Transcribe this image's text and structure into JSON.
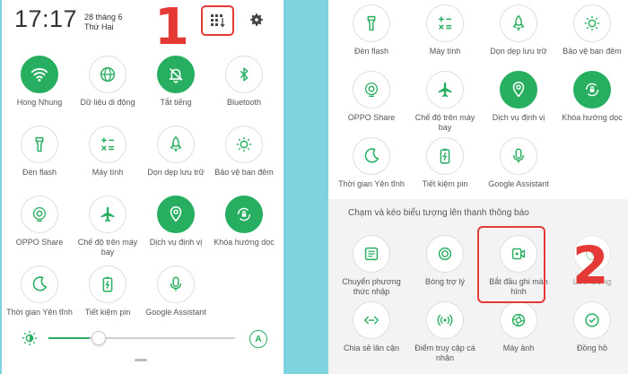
{
  "left_panel": {
    "time": "17:17",
    "date_line1": "28 tháng 6",
    "date_line2": "Thứ Hai",
    "tiles": [
      {
        "label": "Hong Nhung",
        "icon": "wifi-icon",
        "on": true
      },
      {
        "label": "Dữ liệu di động",
        "icon": "globe-icon",
        "on": false
      },
      {
        "label": "Tắt tiếng",
        "icon": "bell-off-icon",
        "on": true
      },
      {
        "label": "Bluetooth",
        "icon": "bluetooth-icon",
        "on": false
      },
      {
        "label": "Đèn flash",
        "icon": "flashlight-icon",
        "on": false
      },
      {
        "label": "Máy tính",
        "icon": "calculator-icon",
        "on": false
      },
      {
        "label": "Dọn dẹp lưu trữ",
        "icon": "rocket-icon",
        "on": false
      },
      {
        "label": "Bảo vệ ban đêm",
        "icon": "eye-comfort-icon",
        "on": false
      },
      {
        "label": "OPPO Share",
        "icon": "share-icon",
        "on": false
      },
      {
        "label": "Chế độ trên máy bay",
        "icon": "airplane-icon",
        "on": false
      },
      {
        "label": "Dịch vụ định vị",
        "icon": "location-icon",
        "on": true
      },
      {
        "label": "Khóa hướng dọc",
        "icon": "rotation-lock-icon",
        "on": true
      },
      {
        "label": "Thời gian Yên tĩnh",
        "icon": "moon-icon",
        "on": false
      },
      {
        "label": "Tiết kiệm pin",
        "icon": "battery-saver-icon",
        "on": false
      },
      {
        "label": "Google Assistant",
        "icon": "microphone-icon",
        "on": false
      }
    ],
    "brightness": 0.22,
    "auto_label": "A"
  },
  "right_panel": {
    "active_tiles": [
      {
        "label": "Đèn flash",
        "icon": "flashlight-icon",
        "on": false
      },
      {
        "label": "Máy tính",
        "icon": "calculator-icon",
        "on": false
      },
      {
        "label": "Dọn dẹp lưu trữ",
        "icon": "rocket-icon",
        "on": false
      },
      {
        "label": "Bảo vệ ban đêm",
        "icon": "eye-comfort-icon",
        "on": false
      },
      {
        "label": "OPPO Share",
        "icon": "share-icon",
        "on": false
      },
      {
        "label": "Chế độ trên máy bay",
        "icon": "airplane-icon",
        "on": false
      },
      {
        "label": "Dịch vụ định vị",
        "icon": "location-icon",
        "on": true
      },
      {
        "label": "Khóa hướng dọc",
        "icon": "rotation-lock-icon",
        "on": true
      },
      {
        "label": "Thời gian Yên tĩnh",
        "icon": "moon-icon",
        "on": false
      },
      {
        "label": "Tiết kiệm pin",
        "icon": "battery-saver-icon",
        "on": false
      },
      {
        "label": "Google Assistant",
        "icon": "microphone-icon",
        "on": false
      }
    ],
    "drag_title": "Chạm và kéo biểu tượng lên thanh thông báo",
    "available_tiles": [
      {
        "label": "Chuyển phương thức nhập",
        "icon": "keyboard-icon"
      },
      {
        "label": "Bóng trợ lý",
        "icon": "assistive-ball-icon"
      },
      {
        "label": "Bắt đầu ghi màn hình",
        "icon": "screen-record-icon"
      },
      {
        "label": "Lưu lượng",
        "icon": "data-usage-icon"
      },
      {
        "label": "Chia sẻ lân cận",
        "icon": "nearby-share-icon"
      },
      {
        "label": "Điểm truy cập cá nhân",
        "icon": "hotspot-icon"
      },
      {
        "label": "Máy ảnh",
        "icon": "camera-icon"
      },
      {
        "label": "Đồng hồ",
        "icon": "clock-icon"
      }
    ]
  },
  "annotations": {
    "step1": "1",
    "step2": "2"
  },
  "colors": {
    "accent": "#27ae60",
    "highlight": "#e53935",
    "background": "#7fd3de"
  }
}
